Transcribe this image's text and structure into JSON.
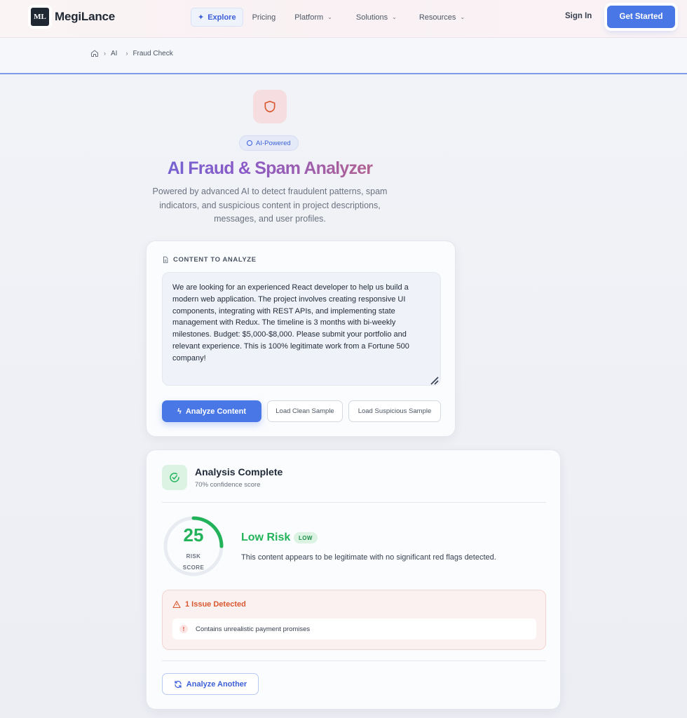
{
  "header": {
    "logo_mark": "ML",
    "brand": "MegiLance",
    "nav": [
      {
        "label": "Explore",
        "active": true
      },
      {
        "label": "Pricing"
      },
      {
        "label": "Platform",
        "dropdown": true
      },
      {
        "label": "Solutions",
        "dropdown": true
      },
      {
        "label": "Resources",
        "dropdown": true
      }
    ],
    "sign_in": "Sign In",
    "get_started": "Get Started"
  },
  "breadcrumb": {
    "items": [
      "AI",
      "Fraud Check"
    ]
  },
  "hero": {
    "badge": "AI-Powered",
    "title": "AI Fraud & Spam Analyzer",
    "subtitle": "Powered by advanced AI to detect fraudulent patterns, spam indicators, and suspicious content in project descriptions, messages, and user profiles."
  },
  "analyze": {
    "label": "CONTENT TO ANALYZE",
    "content": "We are looking for an experienced React developer to help us build a modern web application. The project involves creating responsive UI components, integrating with REST APIs, and implementing state management with Redux. The timeline is 3 months with bi-weekly milestones. Budget: $5,000-$8,000. Please submit your portfolio and relevant experience. This is 100% legitimate work from a Fortune 500 company!",
    "analyze_button": "Analyze Content",
    "clean_sample_button": "Load Clean Sample",
    "suspicious_sample_button": "Load Suspicious Sample"
  },
  "result": {
    "title": "Analysis Complete",
    "confidence": "70% confidence score",
    "risk_score": 25,
    "risk_score_max": 100,
    "risk_label_line1": "RISK",
    "risk_label_line2": "SCORE",
    "risk_level_title": "Low Risk",
    "risk_badge": "LOW",
    "risk_description": "This content appears to be legitimate with no significant red flags detected.",
    "issues_title": "1 Issue Detected",
    "issues": [
      "Contains unrealistic payment promises"
    ],
    "analyze_another": "Analyze Another"
  },
  "colors": {
    "primary": "#4a77e6",
    "success": "#22b35a",
    "warning": "#d9582f"
  }
}
